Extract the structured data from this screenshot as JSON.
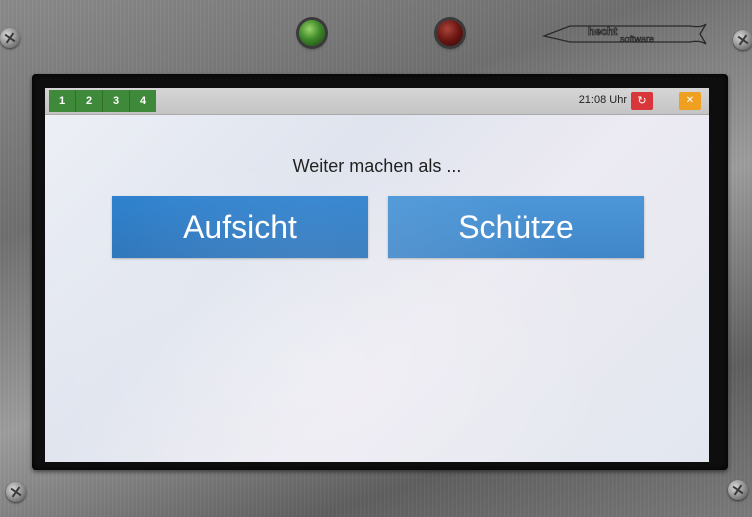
{
  "device": {
    "brand_logo_text": "hecht software",
    "indicators": [
      "green-led",
      "red-led"
    ]
  },
  "topbar": {
    "tabs": [
      "1",
      "2",
      "3",
      "4"
    ],
    "clock": "21:08 Uhr",
    "refresh_icon": "refresh-icon",
    "close_icon": "close-icon",
    "colors": {
      "tabs": "#3f8a3a",
      "refresh": "#d8363a",
      "close": "#f0a020"
    }
  },
  "main": {
    "prompt": "Weiter machen als ...",
    "buttons": {
      "aufsicht": "Aufsicht",
      "schuetze": "Schütze"
    },
    "colors": {
      "aufsicht": "#2a78c2",
      "schuetze": "#4690d0"
    }
  }
}
